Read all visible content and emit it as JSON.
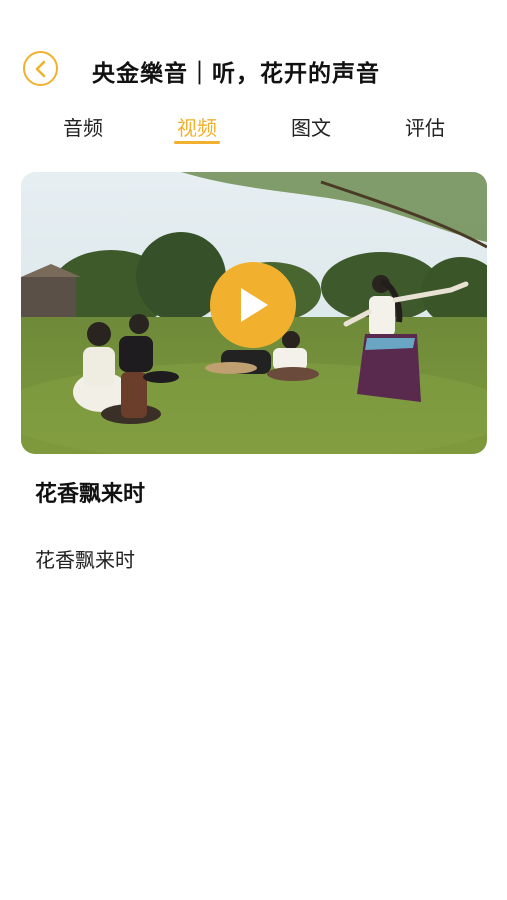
{
  "header": {
    "title": "央金樂音｜听，花开的声音",
    "back_icon": "chevron-left-icon"
  },
  "tabs": [
    {
      "label": "音频",
      "active": false
    },
    {
      "label": "视频",
      "active": true
    },
    {
      "label": "图文",
      "active": false
    },
    {
      "label": "评估",
      "active": false
    }
  ],
  "video": {
    "play_icon": "play-icon",
    "title": "花香飘来时",
    "description": "花香飘来时"
  },
  "colors": {
    "accent": "#f1b12e",
    "text": "#111111",
    "background": "#ffffff"
  }
}
